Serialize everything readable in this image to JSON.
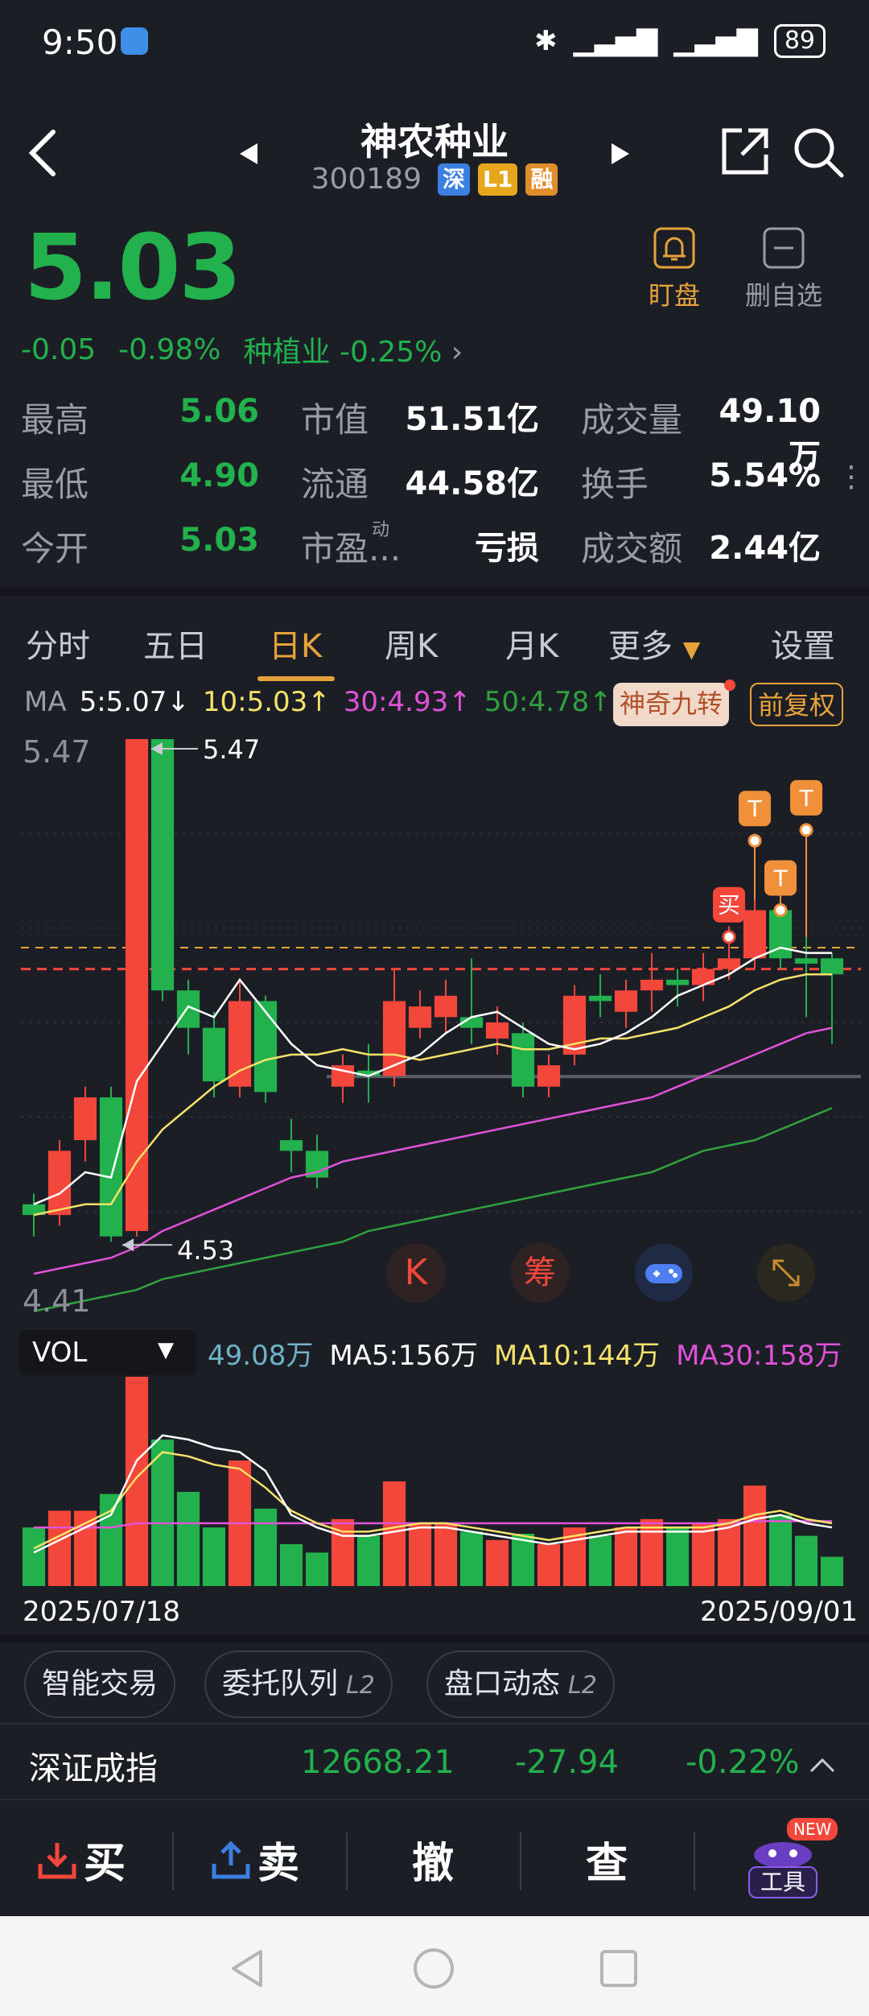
{
  "status_bar": {
    "time": "9:50",
    "battery": "89"
  },
  "header": {
    "title": "神农种业",
    "code": "300189",
    "tags": [
      "深",
      "L1",
      "融"
    ]
  },
  "quote": {
    "price": "5.03",
    "change": "-0.05",
    "change_pct": "-0.98%",
    "sector": "种植业 -0.25%",
    "watch_label": "盯盘",
    "remove_label": "删自选"
  },
  "stats": [
    [
      {
        "label": "最高",
        "value": "5.06",
        "color": "green"
      },
      {
        "label": "市值",
        "value": "51.51亿"
      },
      {
        "label": "成交量",
        "value": "49.10万"
      }
    ],
    [
      {
        "label": "最低",
        "value": "4.90",
        "color": "green"
      },
      {
        "label": "流通",
        "value": "44.58亿"
      },
      {
        "label": "换手",
        "value": "5.54%"
      }
    ],
    [
      {
        "label": "今开",
        "value": "5.03",
        "color": "green"
      },
      {
        "label": "市盈...",
        "value": "亏损"
      },
      {
        "label": "成交额",
        "value": "2.44亿"
      }
    ]
  ],
  "pe_superscript": "动",
  "tabs": [
    "分时",
    "五日",
    "日K",
    "周K",
    "月K",
    "更多",
    "设置"
  ],
  "active_tab": "日K",
  "ma_row": {
    "label": "MA",
    "ma5": "5:5.07↓",
    "ma10": "10:5.03↑",
    "ma30": "30:4.93↑",
    "ma50": "50:4.78↑",
    "magic_btn": "神奇九转",
    "adjust_btn": "前复权"
  },
  "chart_data": {
    "type": "candlestick",
    "y_top_label": "5.47",
    "y_bottom_label": "4.41",
    "ylim": [
      4.41,
      5.47
    ],
    "max_marker": "5.47",
    "min_marker": "4.53",
    "start_date": "2025/07/18",
    "end_date": "2025/09/01",
    "candles": [
      {
        "o": 4.6,
        "c": 4.58,
        "h": 4.62,
        "l": 4.54,
        "v": 28
      },
      {
        "o": 4.58,
        "c": 4.7,
        "h": 4.72,
        "l": 4.56,
        "v": 36
      },
      {
        "o": 4.72,
        "c": 4.8,
        "h": 4.82,
        "l": 4.68,
        "v": 36
      },
      {
        "o": 4.8,
        "c": 4.54,
        "h": 4.82,
        "l": 4.53,
        "v": 44
      },
      {
        "o": 4.55,
        "c": 5.47,
        "h": 5.47,
        "l": 4.54,
        "v": 100
      },
      {
        "o": 5.47,
        "c": 5.0,
        "h": 5.47,
        "l": 4.98,
        "v": 70
      },
      {
        "o": 5.0,
        "c": 4.93,
        "h": 5.02,
        "l": 4.88,
        "v": 45
      },
      {
        "o": 4.93,
        "c": 4.83,
        "h": 4.96,
        "l": 4.8,
        "v": 28
      },
      {
        "o": 4.82,
        "c": 4.98,
        "h": 5.02,
        "l": 4.8,
        "v": 60
      },
      {
        "o": 4.98,
        "c": 4.81,
        "h": 4.99,
        "l": 4.79,
        "v": 37
      },
      {
        "o": 4.72,
        "c": 4.7,
        "h": 4.76,
        "l": 4.66,
        "v": 20
      },
      {
        "o": 4.7,
        "c": 4.65,
        "h": 4.73,
        "l": 4.63,
        "v": 16
      },
      {
        "o": 4.82,
        "c": 4.86,
        "h": 4.88,
        "l": 4.79,
        "v": 32
      },
      {
        "o": 4.85,
        "c": 4.84,
        "h": 4.9,
        "l": 4.79,
        "v": 24
      },
      {
        "o": 4.84,
        "c": 4.98,
        "h": 5.04,
        "l": 4.82,
        "v": 50
      },
      {
        "o": 4.93,
        "c": 4.97,
        "h": 5.0,
        "l": 4.91,
        "v": 30
      },
      {
        "o": 4.95,
        "c": 4.99,
        "h": 5.02,
        "l": 4.92,
        "v": 30
      },
      {
        "o": 4.95,
        "c": 4.93,
        "h": 5.06,
        "l": 4.9,
        "v": 26
      },
      {
        "o": 4.91,
        "c": 4.94,
        "h": 4.97,
        "l": 4.88,
        "v": 22
      },
      {
        "o": 4.92,
        "c": 4.82,
        "h": 4.94,
        "l": 4.8,
        "v": 25
      },
      {
        "o": 4.82,
        "c": 4.86,
        "h": 4.88,
        "l": 4.8,
        "v": 20
      },
      {
        "o": 4.88,
        "c": 4.99,
        "h": 5.01,
        "l": 4.86,
        "v": 28
      },
      {
        "o": 4.99,
        "c": 4.98,
        "h": 5.03,
        "l": 4.95,
        "v": 24
      },
      {
        "o": 4.96,
        "c": 5.0,
        "h": 5.02,
        "l": 4.93,
        "v": 28
      },
      {
        "o": 5.0,
        "c": 5.02,
        "h": 5.07,
        "l": 4.96,
        "v": 32
      },
      {
        "o": 5.02,
        "c": 5.01,
        "h": 5.04,
        "l": 4.97,
        "v": 28
      },
      {
        "o": 5.01,
        "c": 5.04,
        "h": 5.07,
        "l": 4.98,
        "v": 30
      },
      {
        "o": 5.04,
        "c": 5.06,
        "h": 5.12,
        "l": 5.02,
        "v": 32
      },
      {
        "o": 5.06,
        "c": 5.15,
        "h": 5.17,
        "l": 5.04,
        "v": 48
      },
      {
        "o": 5.15,
        "c": 5.06,
        "h": 5.18,
        "l": 5.04,
        "v": 34
      },
      {
        "o": 5.06,
        "c": 5.05,
        "h": 5.1,
        "l": 4.95,
        "v": 24
      },
      {
        "o": 5.06,
        "c": 5.03,
        "h": 5.07,
        "l": 4.9,
        "v": 14
      }
    ],
    "ma5": [
      4.6,
      4.62,
      4.66,
      4.65,
      4.83,
      4.9,
      4.97,
      4.95,
      5.02,
      4.96,
      4.9,
      4.86,
      4.85,
      4.84,
      4.86,
      4.88,
      4.92,
      4.95,
      4.96,
      4.93,
      4.9,
      4.89,
      4.9,
      4.92,
      4.95,
      4.99,
      5.01,
      5.03,
      5.06,
      5.08,
      5.07,
      5.07
    ],
    "ma10": [
      4.58,
      4.59,
      4.6,
      4.6,
      4.68,
      4.74,
      4.78,
      4.82,
      4.85,
      4.87,
      4.88,
      4.88,
      4.89,
      4.88,
      4.88,
      4.87,
      4.88,
      4.89,
      4.9,
      4.89,
      4.89,
      4.9,
      4.91,
      4.91,
      4.92,
      4.93,
      4.95,
      4.97,
      5.0,
      5.02,
      5.03,
      5.03
    ],
    "ma30": [
      4.47,
      4.48,
      4.49,
      4.5,
      4.52,
      4.55,
      4.57,
      4.59,
      4.61,
      4.63,
      4.65,
      4.66,
      4.68,
      4.69,
      4.7,
      4.71,
      4.72,
      4.73,
      4.74,
      4.75,
      4.76,
      4.77,
      4.78,
      4.79,
      4.8,
      4.82,
      4.84,
      4.86,
      4.88,
      4.9,
      4.92,
      4.93
    ],
    "ma50": [
      4.4,
      4.41,
      4.42,
      4.43,
      4.44,
      4.46,
      4.47,
      4.48,
      4.49,
      4.5,
      4.51,
      4.52,
      4.53,
      4.55,
      4.56,
      4.57,
      4.58,
      4.59,
      4.6,
      4.61,
      4.62,
      4.63,
      4.64,
      4.65,
      4.66,
      4.68,
      4.7,
      4.71,
      4.72,
      4.74,
      4.76,
      4.78
    ],
    "vol_ma": [
      18,
      24,
      30,
      36,
      52,
      64,
      62,
      58,
      56,
      47,
      36,
      30,
      26,
      26,
      28,
      30,
      30,
      28,
      26,
      24,
      22,
      24,
      26,
      28,
      28,
      28,
      28,
      30,
      34,
      36,
      32,
      30
    ],
    "vol_ma30": [
      28,
      28,
      28,
      28,
      30,
      30,
      30,
      30,
      30,
      30,
      30,
      30,
      30,
      30,
      30,
      30,
      30,
      30,
      30,
      30,
      30,
      30,
      30,
      30,
      30,
      30,
      30,
      30,
      31,
      31,
      31,
      31
    ],
    "markers": [
      {
        "idx": 27,
        "label": "买",
        "price": 5.1
      },
      {
        "idx": 28,
        "label": "T",
        "price": 5.28
      },
      {
        "idx": 29,
        "label": "T",
        "price": 5.15
      },
      {
        "idx": 30,
        "label": "T",
        "price": 5.3
      }
    ],
    "ref_line_orange": 5.08,
    "ref_line_red": 5.04,
    "support_line": 4.86
  },
  "vol_row": {
    "label": "VOL",
    "value": "49.08万",
    "ma5": "MA5:156万",
    "ma10": "MA10:144万",
    "ma30": "MA30:158万"
  },
  "tool_icons": [
    "K",
    "筹"
  ],
  "chips": [
    "智能交易",
    "委托队列",
    "盘口动态"
  ],
  "chip_badge": "L2",
  "index": {
    "name": "深证成指",
    "value": "12668.21",
    "change": "-27.94",
    "pct": "-0.22%"
  },
  "trade_bar": {
    "buy": "买",
    "sell": "卖",
    "cancel": "撤",
    "query": "查",
    "tools": "工具",
    "new_badge": "NEW"
  },
  "colors": {
    "up": "#f2473a",
    "down": "#22b14c",
    "accent": "#e7a33b",
    "bg": "#1c1e26"
  }
}
